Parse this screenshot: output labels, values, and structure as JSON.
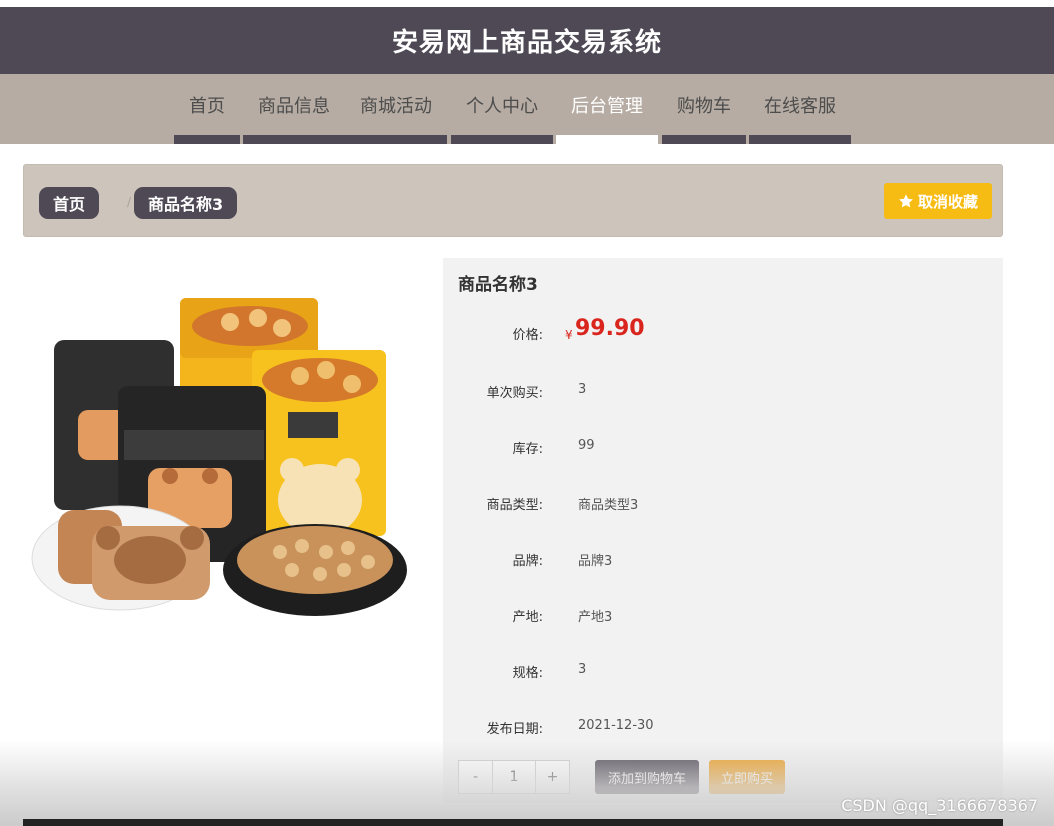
{
  "site": {
    "title": "安易网上商品交易系统"
  },
  "nav": {
    "items": [
      {
        "label": "首页"
      },
      {
        "label": "商品信息"
      },
      {
        "label": "商城活动"
      },
      {
        "label": "个人中心"
      },
      {
        "label": "后台管理",
        "active": true
      },
      {
        "label": "购物车"
      },
      {
        "label": "在线客服"
      }
    ]
  },
  "breadcrumb": {
    "home": "首页",
    "separator": "/",
    "current": "商品名称3"
  },
  "favorite": {
    "label": "取消收藏",
    "icon": "star-icon"
  },
  "product": {
    "name": "商品名称3",
    "price_label": "价格:",
    "currency": "¥",
    "price": "99.90",
    "fields": [
      {
        "label": "单次购买:",
        "value": "3"
      },
      {
        "label": "库存:",
        "value": "99"
      },
      {
        "label": "商品类型:",
        "value": "商品类型3"
      },
      {
        "label": "品牌:",
        "value": "品牌3"
      },
      {
        "label": "产地:",
        "value": "产地3"
      },
      {
        "label": "规格:",
        "value": "3"
      },
      {
        "label": "发布日期:",
        "value": "2021-12-30"
      }
    ],
    "image_alt": "snack product packages"
  },
  "quantity": {
    "minus": "-",
    "value": "1",
    "plus": "+"
  },
  "actions": {
    "add_to_cart": "添加到购物车",
    "buy_now": "立即购买"
  },
  "watermark": "CSDN @qq_3166678367",
  "colors": {
    "header": "#4f4955",
    "nav": "#b6aca3",
    "price": "#d9251d",
    "favorite": "#f7bc14",
    "buy": "#ec9e22"
  }
}
